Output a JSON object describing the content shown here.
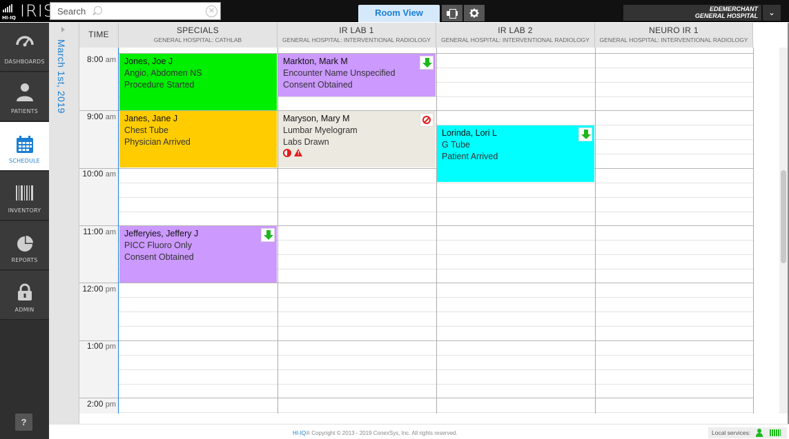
{
  "app": {
    "logo_small": "HI-IQ",
    "logo_name": "IRIS"
  },
  "search": {
    "placeholder": "Search"
  },
  "toolbar": {
    "room_view_label": "Room View"
  },
  "user": {
    "name": "EDEMERCHANT",
    "facility": "GENERAL HOSPITAL"
  },
  "sidebar": {
    "items": [
      {
        "label": "DASHBOARDS",
        "icon": "gauge-icon"
      },
      {
        "label": "PATIENTS",
        "icon": "person-icon"
      },
      {
        "label": "SCHEDULE",
        "icon": "calendar-icon",
        "active": true
      },
      {
        "label": "INVENTORY",
        "icon": "barcode-icon"
      },
      {
        "label": "REPORTS",
        "icon": "pie-chart-icon"
      },
      {
        "label": "ADMIN",
        "icon": "lock-icon"
      }
    ],
    "help_label": "?"
  },
  "schedule": {
    "date": "March 1st, 2019",
    "time_header": "TIME",
    "rooms": [
      {
        "name": "SPECIALS",
        "sub": "GENERAL HOSPITAL: CATHLAB"
      },
      {
        "name": "IR LAB 1",
        "sub": "GENERAL HOSPITAL: INTERVENTIONAL RADIOLOGY"
      },
      {
        "name": "IR LAB 2",
        "sub": "GENERAL HOSPITAL: INTERVENTIONAL RADIOLOGY"
      },
      {
        "name": "NEURO IR 1",
        "sub": "GENERAL HOSPITAL: INTERVENTIONAL RADIOLOGY"
      }
    ],
    "time_labels": [
      {
        "h": "8:00",
        "ap": "am"
      },
      {
        "h": "9:00",
        "ap": "am"
      },
      {
        "h": "10:00",
        "ap": "am"
      },
      {
        "h": "11:00",
        "ap": "am"
      },
      {
        "h": "12:00",
        "ap": "pm"
      },
      {
        "h": "1:00",
        "ap": "pm"
      },
      {
        "h": "2:00",
        "ap": "pm"
      }
    ],
    "appointments": [
      {
        "name": "Jones, Joe J",
        "procedure": "Angio, Abdomen NS",
        "status": "Procedure Started",
        "room": 0,
        "start": "8:00 am",
        "end": "9:00 am",
        "color": "#00ee00"
      },
      {
        "name": "Markton, Mark M",
        "procedure": "Encounter Name Unspecified",
        "status": "Consent Obtained",
        "room": 1,
        "start": "8:00 am",
        "end": "8:45 am",
        "color": "#cc99ff",
        "icon": "down-arrow-icon"
      },
      {
        "name": "Janes, Jane J",
        "procedure": "Chest Tube",
        "status": "Physician Arrived",
        "room": 0,
        "start": "9:00 am",
        "end": "10:00 am",
        "color": "#ffcc00"
      },
      {
        "name": "Maryson, Mary M",
        "procedure": "Lumbar Myelogram",
        "status": "Labs Drawn",
        "room": 1,
        "start": "9:00 am",
        "end": "10:00 am",
        "color": "#ebe9e0",
        "icon": "no-entry-icon"
      },
      {
        "name": "Lorinda, Lori L",
        "procedure": "G Tube",
        "status": "Patient Arrived",
        "room": 2,
        "start": "9:15 am",
        "end": "10:15 am",
        "color": "#00ffff",
        "icon": "down-arrow-icon"
      },
      {
        "name": "Jefferyies, Jeffery J",
        "procedure": "PICC Fluoro Only",
        "status": "Consent Obtained",
        "room": 0,
        "start": "11:00 am",
        "end": "12:00 pm",
        "color": "#cc99ff",
        "icon": "down-arrow-icon"
      }
    ]
  },
  "footer": {
    "copyright_brand": "HI-IQ",
    "copyright_text": "® Copyright © 2013 - 2019 ConexSys, Inc. All rights reserved.",
    "local_services_label": "Local services:"
  },
  "colors": {
    "accent": "#1a7fd4",
    "status_green": "#1db81d",
    "alert_red": "#e31b1b"
  }
}
